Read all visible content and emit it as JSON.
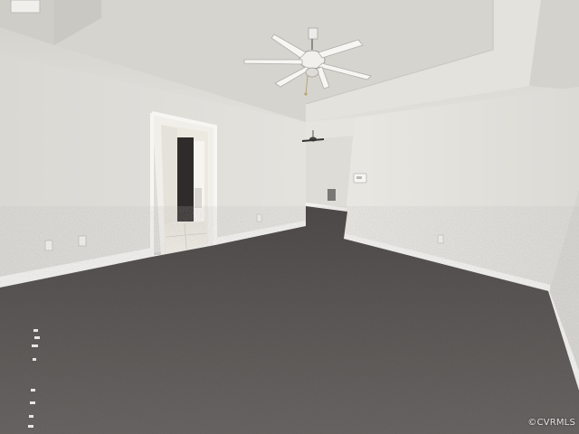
{
  "photo": {
    "subject": "empty-room-interior",
    "features": [
      "tray-ceiling",
      "ceiling-fan",
      "carpet-floor",
      "doorway-to-tiled-room",
      "adjoining-room-with-ceiling-fan",
      "baseboards",
      "wall-outlets",
      "thermostat"
    ]
  },
  "watermark": {
    "text": "©CVRMLS"
  },
  "colors": {
    "wall": "#e6e4df",
    "ceiling": "#d9d7d2",
    "carpet": "#5e5b59",
    "baseboard": "#f4f3f0"
  }
}
